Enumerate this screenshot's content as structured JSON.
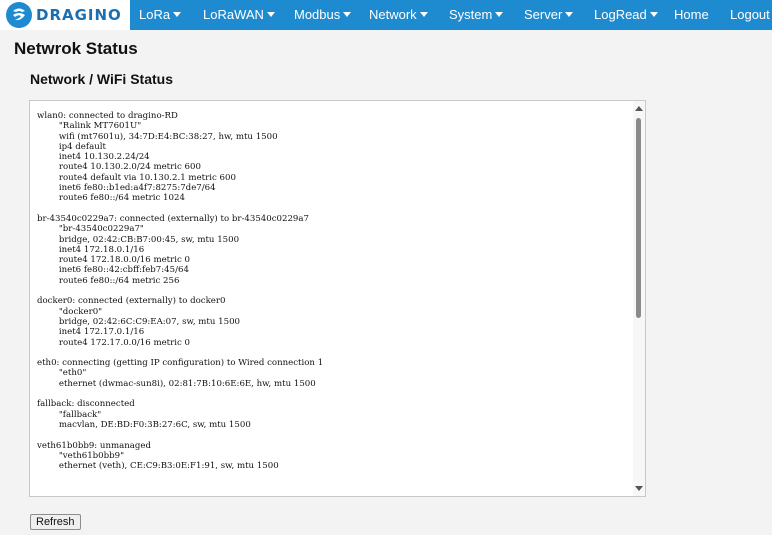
{
  "brand": {
    "logo_text": "DRAGINO",
    "logo_icon": "dragino-logo-icon",
    "accent": "#1e8bd0"
  },
  "nav": {
    "items": [
      {
        "label": "LoRa",
        "has_dropdown": true
      },
      {
        "label": "LoRaWAN",
        "has_dropdown": true
      },
      {
        "label": "Modbus",
        "has_dropdown": true
      },
      {
        "label": "Network",
        "has_dropdown": true
      },
      {
        "label": "System",
        "has_dropdown": true
      },
      {
        "label": "Server",
        "has_dropdown": true
      },
      {
        "label": "LogRead",
        "has_dropdown": true
      },
      {
        "label": "Home",
        "has_dropdown": false
      },
      {
        "label": "Logout",
        "has_dropdown": false
      }
    ]
  },
  "page": {
    "title": "Netwrok Status",
    "section_title": "Network / WiFi Status",
    "status_text": "wlan0: connected to dragino-RD\n        \"Ralink MT7601U\"\n        wifi (mt7601u), 34:7D:E4:BC:38:27, hw, mtu 1500\n        ip4 default\n        inet4 10.130.2.24/24\n        route4 10.130.2.0/24 metric 600\n        route4 default via 10.130.2.1 metric 600\n        inet6 fe80::b1ed:a4f7:8275:7de7/64\n        route6 fe80::/64 metric 1024\n\nbr-43540c0229a7: connected (externally) to br-43540c0229a7\n        \"br-43540c0229a7\"\n        bridge, 02:42:CB:B7:00:45, sw, mtu 1500\n        inet4 172.18.0.1/16\n        route4 172.18.0.0/16 metric 0\n        inet6 fe80::42:cbff:feb7:45/64\n        route6 fe80::/64 metric 256\n\ndocker0: connected (externally) to docker0\n        \"docker0\"\n        bridge, 02:42:6C:C9:EA:07, sw, mtu 1500\n        inet4 172.17.0.1/16\n        route4 172.17.0.0/16 metric 0\n\neth0: connecting (getting IP configuration) to Wired connection 1\n        \"eth0\"\n        ethernet (dwmac-sun8i), 02:81:7B:10:6E:6E, hw, mtu 1500\n\nfallback: disconnected\n        \"fallback\"\n        macvlan, DE:BD:F0:3B:27:6C, sw, mtu 1500\n\nveth61b0bb9: unmanaged\n        \"veth61b0bb9\"\n        ethernet (veth), CE:C9:B3:0E:F1:91, sw, mtu 1500",
    "refresh_label": "Refresh"
  }
}
